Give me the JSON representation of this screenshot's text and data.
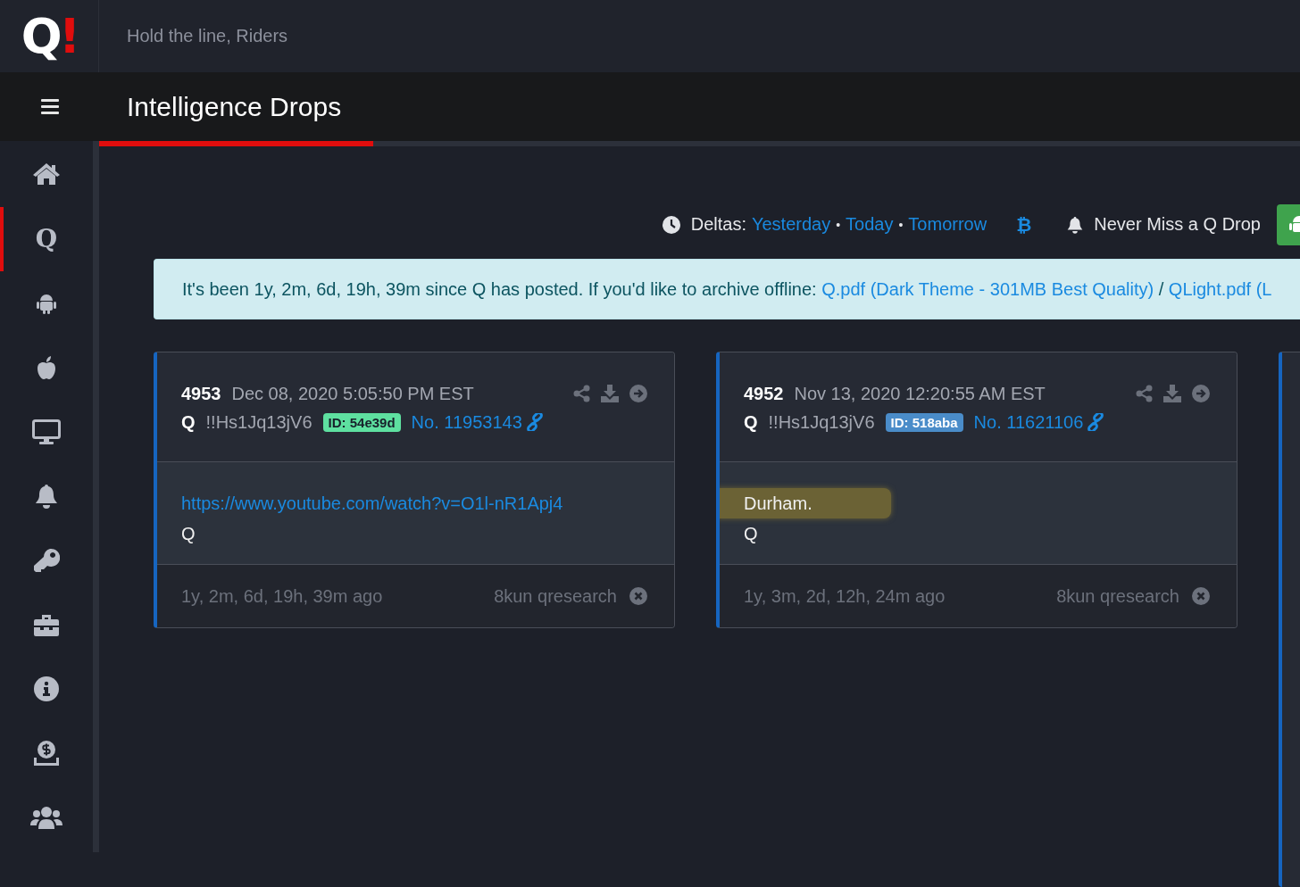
{
  "logo": {
    "letter": "Q",
    "mark": "!"
  },
  "tagline": "Hold the line, Riders",
  "page_title": "Intelligence Drops",
  "sidebar": {
    "items": [
      {
        "kind": "home",
        "selected": false
      },
      {
        "kind": "q",
        "glyph": "Q",
        "selected": true
      },
      {
        "kind": "android",
        "selected": false
      },
      {
        "kind": "apple",
        "selected": false
      },
      {
        "kind": "desktop",
        "selected": false
      },
      {
        "kind": "bell",
        "selected": false
      },
      {
        "kind": "key",
        "selected": false
      },
      {
        "kind": "toolbox",
        "selected": false
      },
      {
        "kind": "info",
        "selected": false
      },
      {
        "kind": "donate",
        "selected": false
      },
      {
        "kind": "users",
        "selected": false
      }
    ]
  },
  "toolbar": {
    "deltas_label": "Deltas:",
    "deltas": [
      "Yesterday",
      "Today",
      "Tomorrow"
    ],
    "separator": "•",
    "bitcoin": "₿",
    "notify": "Never Miss a Q Drop"
  },
  "alert": {
    "text": "It's been 1y, 2m, 6d, 19h, 39m since Q has posted. If you'd like to archive offline: ",
    "links": [
      "Q.pdf (Dark Theme - 301MB Best Quality)",
      "QLight.pdf (L"
    ],
    "separator": " / "
  },
  "posts": [
    {
      "number": "4953",
      "date": "Dec 08, 2020 5:05:50 PM EST",
      "author": "Q",
      "tripcode": "!!Hs1Jq13jV6",
      "id_badge": "ID: 54e39d",
      "color": "#5ee0a0",
      "post_no": "No. 11953143",
      "lines": [
        {
          "kind": "link",
          "text": "https://www.youtube.com/watch?v=O1l-nR1Apj4",
          "highlighted": false
        },
        {
          "kind": "text",
          "text": "Q",
          "highlighted": false
        }
      ],
      "age": "1y, 2m, 6d, 19h, 39m ago",
      "source": "8kun qresearch"
    },
    {
      "number": "4952",
      "date": "Nov 13, 2020 12:20:55 AM EST",
      "author": "Q",
      "tripcode": "!!Hs1Jq13jV6",
      "id_badge": "ID: 518aba",
      "color": "#4a8cc9",
      "post_no": "No. 11621106",
      "lines": [
        {
          "kind": "text",
          "text": "Durham.",
          "highlighted": true
        },
        {
          "kind": "text",
          "text": "Q",
          "highlighted": false
        }
      ],
      "age": "1y, 3m, 2d, 12h, 24m ago",
      "source": "8kun qresearch"
    }
  ]
}
